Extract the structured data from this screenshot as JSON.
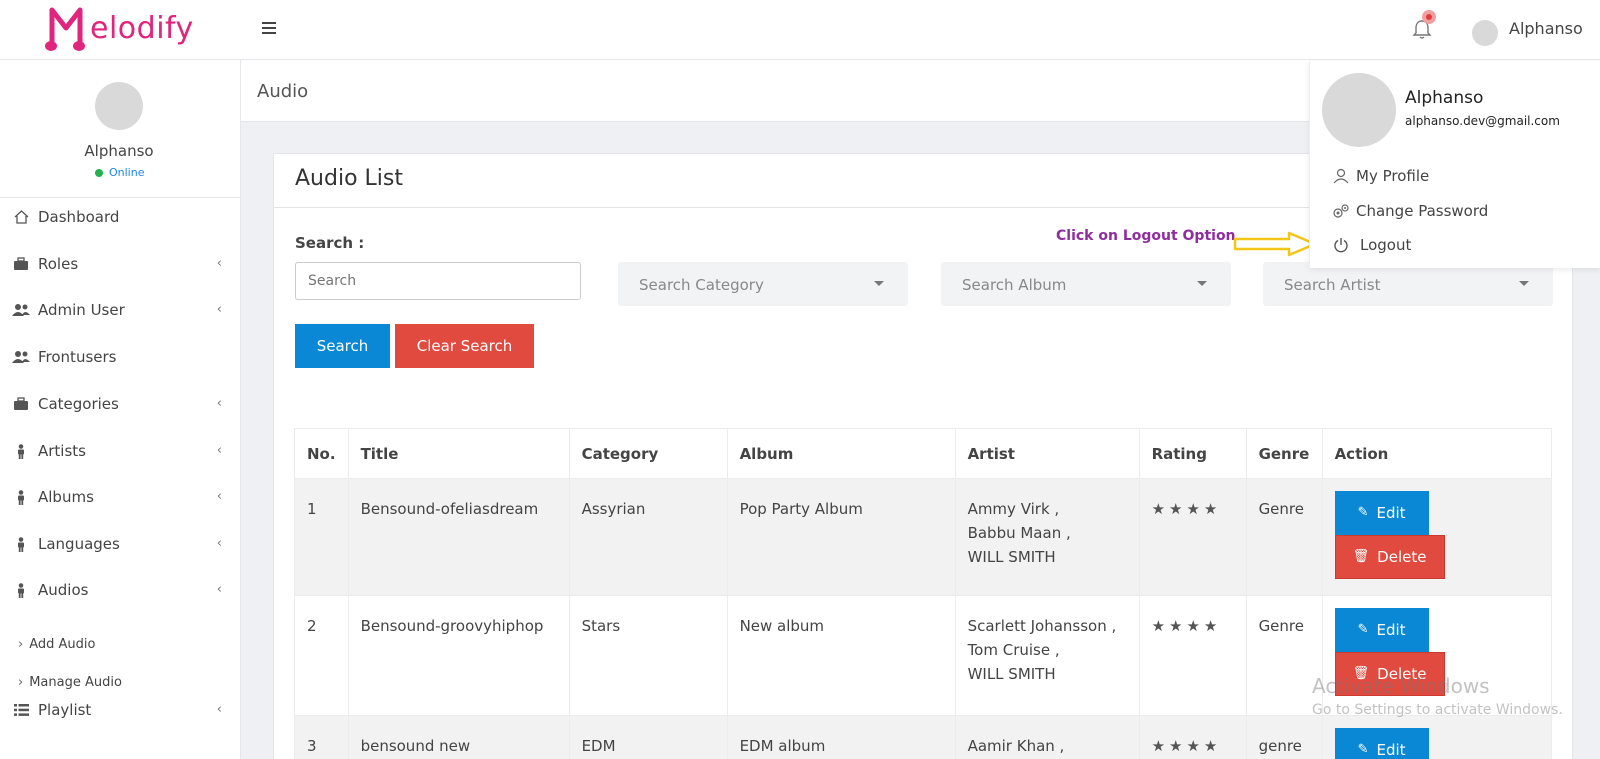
{
  "brand": {
    "name": "elodify",
    "logo_letter": "M",
    "color": "#e0257d"
  },
  "topbar": {
    "username": "Alphanso",
    "menu_icon": "hamburger-icon",
    "notification_icon": "bell-icon"
  },
  "sidebar": {
    "user": {
      "name": "Alphanso",
      "status": "Online"
    },
    "items": [
      {
        "label": "Dashboard",
        "icon": "home-icon"
      },
      {
        "label": "Roles",
        "icon": "briefcase-icon"
      },
      {
        "label": "Admin User",
        "icon": "users-icon"
      },
      {
        "label": "Frontusers",
        "icon": "users-icon"
      },
      {
        "label": "Categories",
        "icon": "briefcase-icon"
      },
      {
        "label": "Artists",
        "icon": "person-icon"
      },
      {
        "label": "Albums",
        "icon": "person-icon"
      },
      {
        "label": "Languages",
        "icon": "person-icon"
      },
      {
        "label": "Audios",
        "icon": "person-icon"
      },
      {
        "label": "Playlist",
        "icon": "list-icon"
      }
    ],
    "sub_items": [
      {
        "label": "Add Audio"
      },
      {
        "label": "Manage Audio"
      }
    ]
  },
  "page": {
    "title": "Audio"
  },
  "card": {
    "title": "Audio List",
    "search_label": "Search :",
    "search_placeholder": "Search",
    "filters": {
      "category": "Search Category",
      "album": "Search Album",
      "artist": "Search Artist"
    },
    "search_button": "Search",
    "clear_button": "Clear Search"
  },
  "hint": "Click on Logout Option",
  "table": {
    "headers": [
      "No.",
      "Title",
      "Category",
      "Album",
      "Artist",
      "Rating",
      "Genre",
      "Action"
    ],
    "rows": [
      {
        "no": "1",
        "title": "Bensound-ofeliasdream",
        "category": "Assyrian",
        "album": "Pop Party Album",
        "artist": [
          "Ammy Virk ,",
          "Babbu Maan ,",
          "WILL SMITH"
        ],
        "rating": "★★★★",
        "genre": "Genre"
      },
      {
        "no": "2",
        "title": "Bensound-groovyhiphop",
        "category": "Stars",
        "album": "New album",
        "artist": [
          "Scarlett Johansson ,",
          "Tom Cruise ,",
          "WILL SMITH"
        ],
        "rating": "★★★★",
        "genre": "Genre"
      },
      {
        "no": "3",
        "title": "bensound new",
        "category": "EDM",
        "album": "EDM album",
        "artist": [
          "Aamir Khan ,"
        ],
        "rating": "★★★★",
        "genre": "genre"
      }
    ],
    "edit_label": "Edit",
    "delete_label": "Delete"
  },
  "dropdown": {
    "name": "Alphanso",
    "email": "alphanso.dev@gmail.com",
    "items": [
      {
        "label": "My Profile",
        "icon": "user-outline-icon"
      },
      {
        "label": "Change Password",
        "icon": "gears-icon"
      },
      {
        "label": "Logout",
        "icon": "power-icon"
      }
    ]
  },
  "watermark": {
    "title": "Activate Windows",
    "subtitle": "Go to Settings to activate Windows."
  },
  "colors": {
    "primary": "#0a88d6",
    "danger": "#e04a3f",
    "hint": "#8e2d9e",
    "arrow": "#f5c518"
  }
}
